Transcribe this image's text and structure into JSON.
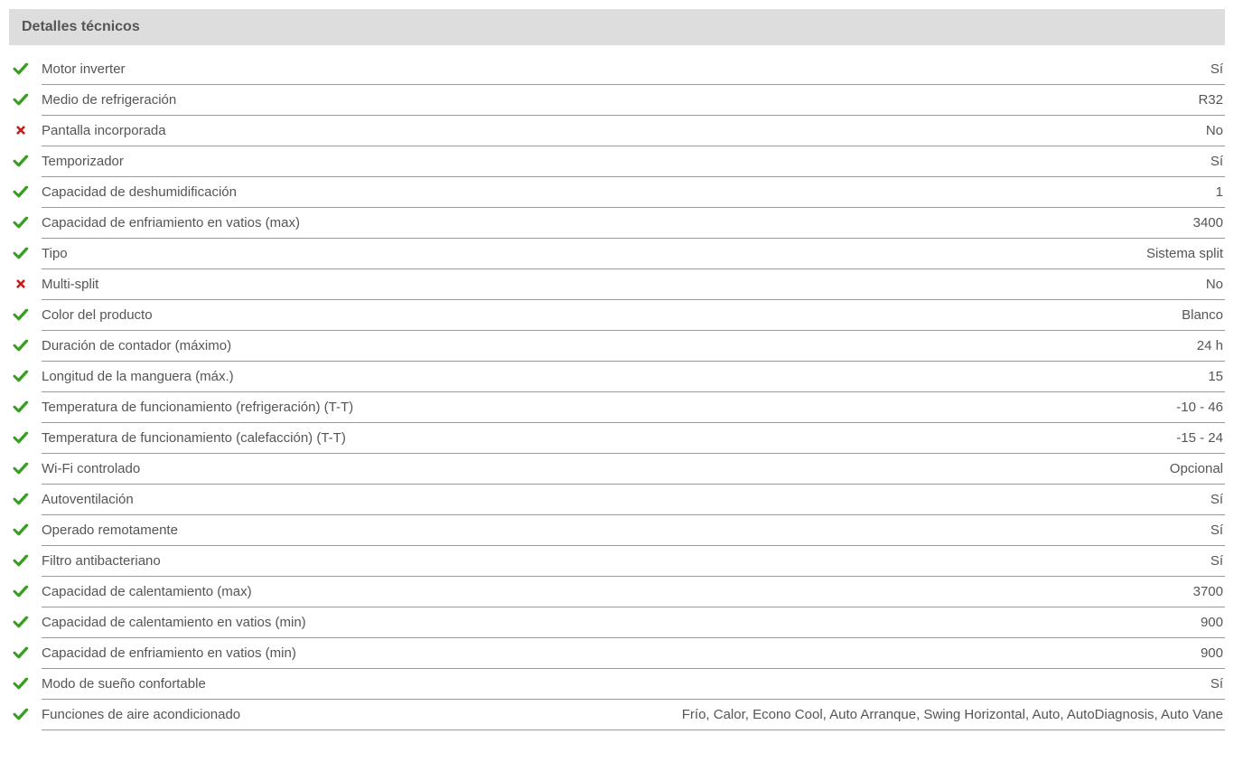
{
  "section": {
    "title": "Detalles técnicos"
  },
  "specs": [
    {
      "ok": true,
      "label": "Motor inverter",
      "value": "Sí"
    },
    {
      "ok": true,
      "label": "Medio de refrigeración",
      "value": "R32"
    },
    {
      "ok": false,
      "label": "Pantalla incorporada",
      "value": "No"
    },
    {
      "ok": true,
      "label": "Temporizador",
      "value": "Sí"
    },
    {
      "ok": true,
      "label": "Capacidad de deshumidificación",
      "value": "1"
    },
    {
      "ok": true,
      "label": "Capacidad de enfriamiento en vatios (max)",
      "value": "3400"
    },
    {
      "ok": true,
      "label": "Tipo",
      "value": "Sistema split"
    },
    {
      "ok": false,
      "label": "Multi-split",
      "value": "No"
    },
    {
      "ok": true,
      "label": "Color del producto",
      "value": "Blanco"
    },
    {
      "ok": true,
      "label": "Duración de contador (máximo)",
      "value": "24 h"
    },
    {
      "ok": true,
      "label": "Longitud de la manguera (máx.)",
      "value": "15"
    },
    {
      "ok": true,
      "label": "Temperatura de funcionamiento (refrigeración) (T-T)",
      "value": "-10 - 46"
    },
    {
      "ok": true,
      "label": "Temperatura de funcionamiento (calefacción) (T-T)",
      "value": "-15 - 24"
    },
    {
      "ok": true,
      "label": "Wi-Fi controlado",
      "value": "Opcional"
    },
    {
      "ok": true,
      "label": "Autoventilación",
      "value": "Sí"
    },
    {
      "ok": true,
      "label": "Operado remotamente",
      "value": "Sí"
    },
    {
      "ok": true,
      "label": "Filtro antibacteriano",
      "value": "Sí"
    },
    {
      "ok": true,
      "label": "Capacidad de calentamiento (max)",
      "value": "3700"
    },
    {
      "ok": true,
      "label": "Capacidad de calentamiento en vatios (min)",
      "value": "900"
    },
    {
      "ok": true,
      "label": "Capacidad de enfriamiento en vatios (min)",
      "value": "900"
    },
    {
      "ok": true,
      "label": "Modo de sueño confortable",
      "value": "Sí"
    },
    {
      "ok": true,
      "label": "Funciones de aire acondicionado",
      "value": "Frío, Calor, Econo Cool, Auto Arranque, Swing Horizontal, Auto, AutoDiagnosis, Auto Vane"
    }
  ]
}
